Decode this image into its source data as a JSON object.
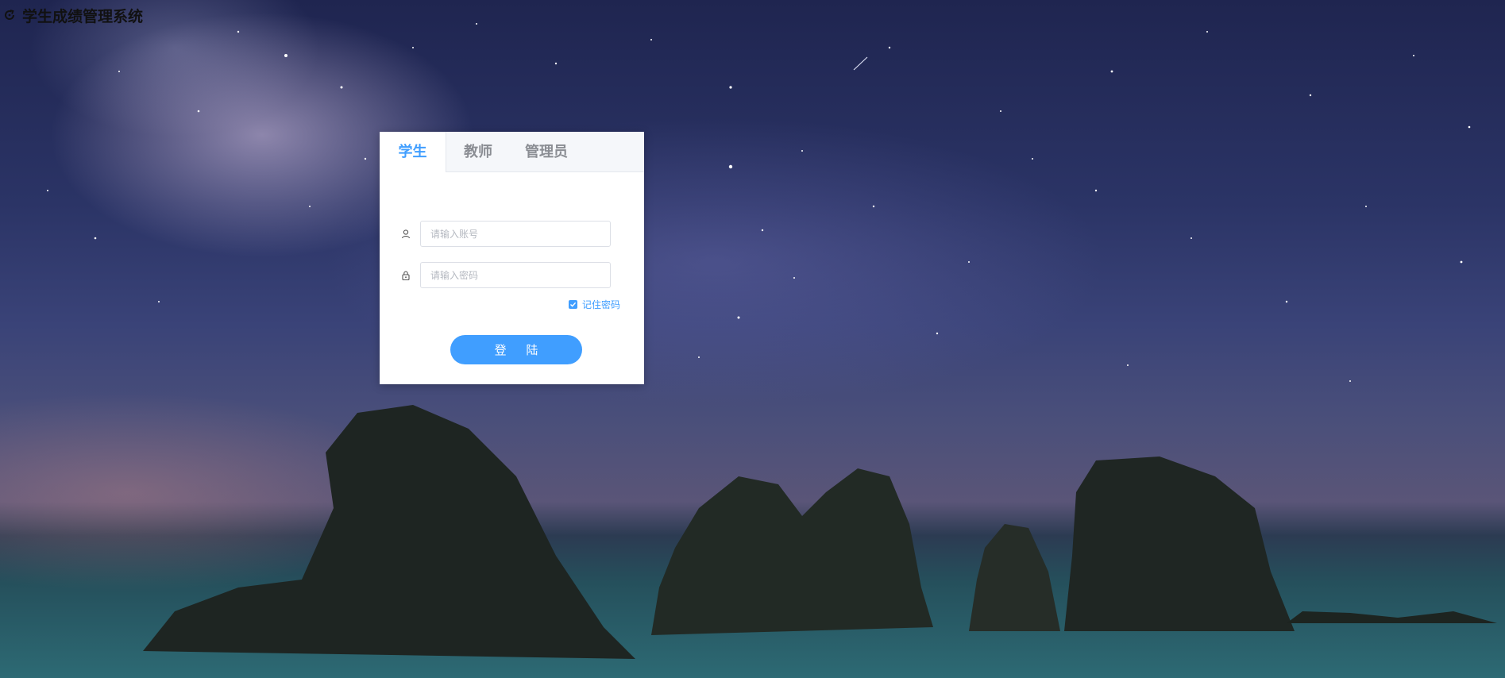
{
  "app": {
    "title": "学生成绩管理系统"
  },
  "login": {
    "tabs": [
      {
        "label": "学生",
        "active": true
      },
      {
        "label": "教师",
        "active": false
      },
      {
        "label": "管理员",
        "active": false
      }
    ],
    "account": {
      "placeholder": "请输入账号",
      "value": "",
      "icon": "user-icon"
    },
    "password": {
      "placeholder": "请输入密码",
      "value": "",
      "icon": "lock-icon"
    },
    "remember": {
      "label": "记住密码",
      "checked": true
    },
    "submit_label": "登 陆"
  },
  "colors": {
    "accent": "#409eff",
    "tab_inactive": "#8a8d93",
    "title": "#111111"
  }
}
